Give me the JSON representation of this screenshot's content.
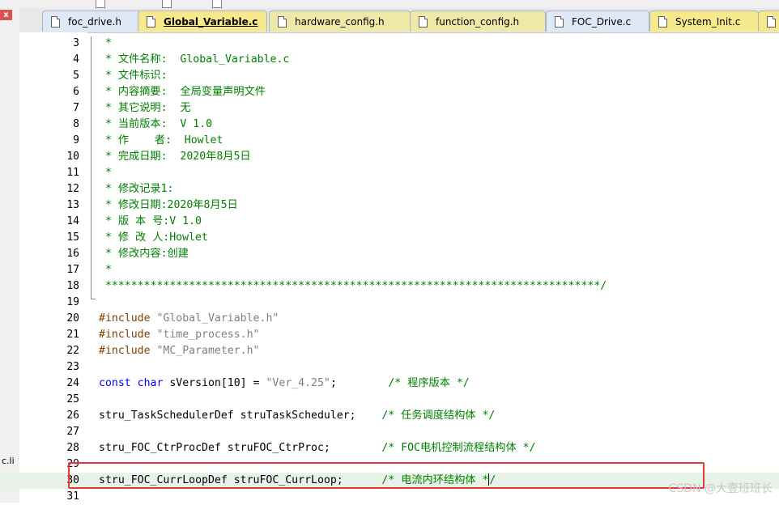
{
  "window": {
    "close_label": "x",
    "side_snippet": "c.li"
  },
  "tabs": [
    {
      "label": "foc_drive.h",
      "active": false,
      "color": "#dfe8f6"
    },
    {
      "label": "Global_Variable.c",
      "active": true,
      "color": "#f5e98b"
    },
    {
      "label": "hardware_config.h",
      "active": false,
      "color": "#f0e8a8"
    },
    {
      "label": "function_config.h",
      "active": false,
      "color": "#f0e8a8"
    },
    {
      "label": "FOC_Drive.c",
      "active": false,
      "color": "#dfe8f6"
    },
    {
      "label": "System_Init.c",
      "active": false,
      "color": "#f5e98b"
    }
  ],
  "editor": {
    "lines": [
      {
        "n": "3",
        "t": " *"
      },
      {
        "n": "4",
        "t": " * 文件名称:  Global_Variable.c"
      },
      {
        "n": "5",
        "t": " * 文件标识:"
      },
      {
        "n": "6",
        "t": " * 内容摘要:  全局变量声明文件"
      },
      {
        "n": "7",
        "t": " * 其它说明:  无"
      },
      {
        "n": "8",
        "t": " * 当前版本:  V 1.0"
      },
      {
        "n": "9",
        "t": " * 作    者:  Howlet"
      },
      {
        "n": "10",
        "t": " * 完成日期:  2020年8月5日"
      },
      {
        "n": "11",
        "t": " *"
      },
      {
        "n": "12",
        "t": " * 修改记录1:"
      },
      {
        "n": "13",
        "t": " * 修改日期:2020年8月5日"
      },
      {
        "n": "14",
        "t": " * 版 本 号:V 1.0"
      },
      {
        "n": "15",
        "t": " * 修 改 人:Howlet"
      },
      {
        "n": "16",
        "t": " * 修改内容:创建"
      },
      {
        "n": "17",
        "t": " *"
      },
      {
        "n": "18",
        "t": " *****************************************************************************/"
      },
      {
        "n": "19",
        "t": ""
      },
      {
        "n": "20",
        "t": "#include \"Global_Variable.h\""
      },
      {
        "n": "21",
        "t": "#include \"time_process.h\""
      },
      {
        "n": "22",
        "t": "#include \"MC_Parameter.h\""
      },
      {
        "n": "23",
        "t": ""
      },
      {
        "n": "24",
        "t": "const char sVersion[10] = \"Ver_4.25\";        /* 程序版本 */"
      },
      {
        "n": "25",
        "t": ""
      },
      {
        "n": "26",
        "t": "stru_TaskSchedulerDef struTaskScheduler;    /* 任务调度结构体 */"
      },
      {
        "n": "27",
        "t": ""
      },
      {
        "n": "28",
        "t": "stru_FOC_CtrProcDef struFOC_CtrProc;        /* FOC电机控制流程结构体 */"
      },
      {
        "n": "29",
        "t": ""
      },
      {
        "n": "30",
        "t": "stru_FOC_CurrLoopDef struFOC_CurrLoop;      /* 电流内环结构体 */"
      },
      {
        "n": "31",
        "t": ""
      }
    ]
  },
  "watermark": "CSDN @大壹班班长"
}
